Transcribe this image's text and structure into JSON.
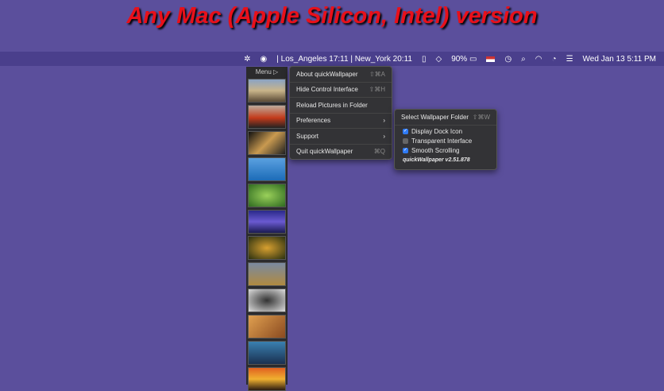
{
  "title": "Any Mac (Apple Silicon, Intel) version",
  "menubar": {
    "clocks": "| Los_Angeles 17:11  | New_York 20:11",
    "battery": "90%",
    "datetime": "Wed Jan 13  5:11 PM"
  },
  "strip": {
    "header": "Menu ▷"
  },
  "menu": {
    "items": [
      {
        "label": "About quickWallpaper",
        "shortcut": "⇧⌘A"
      },
      {
        "label": "Hide Control Interface",
        "shortcut": "⇧⌘H"
      },
      {
        "label": "Reload Pictures in Folder",
        "shortcut": ""
      },
      {
        "label": "Preferences",
        "shortcut": "›"
      },
      {
        "label": "Support",
        "shortcut": "›"
      },
      {
        "label": "Quit quickWallpaper",
        "shortcut": "⌘Q"
      }
    ]
  },
  "submenu": {
    "select": "Select Wallpaper Folder",
    "select_shortcut": "⇧⌘W",
    "options": [
      {
        "label": "Display Dock Icon",
        "checked": true
      },
      {
        "label": "Transparent Interface",
        "checked": false
      },
      {
        "label": "Smooth Scrolling",
        "checked": true
      }
    ],
    "version": "quickWallpaper  v2.51.878"
  }
}
